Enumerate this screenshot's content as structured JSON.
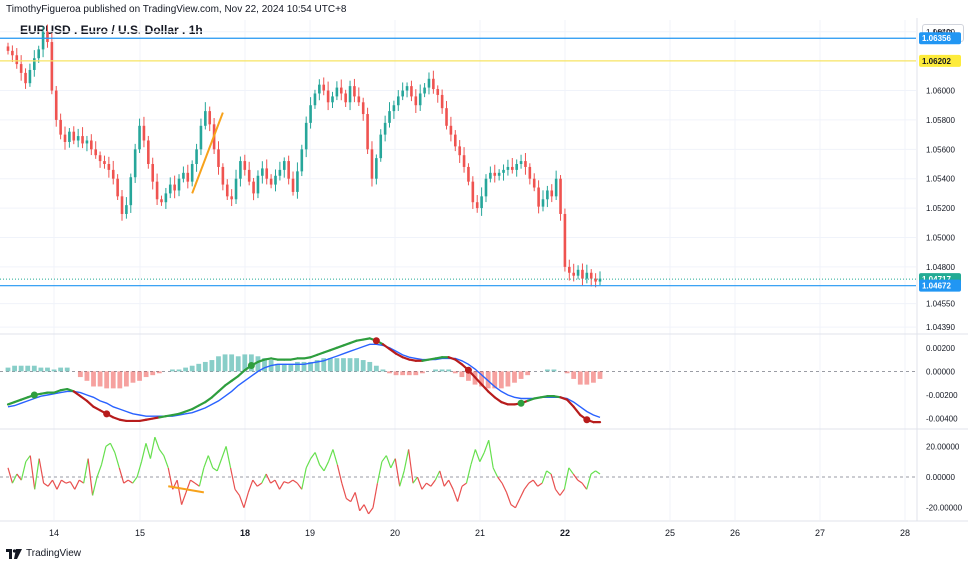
{
  "header": {
    "published_by": "TimothyFigueroa published on TradingView.com, Nov 22, 2024 10:54 UTC+8",
    "symbol_title": "EURUSD . Euro / U.S. Dollar . 1h",
    "currency_button": "USD"
  },
  "footer": {
    "brand": "TradingView"
  },
  "colors": {
    "up": "#26a69a",
    "down": "#ef5350",
    "blue_line": "#2196f3",
    "yellow_line": "#f7e463",
    "orange_trendline": "#f7a21b",
    "green_tag": "#22ab94",
    "blue_tag": "#2196f3",
    "yellow_tag": "#fdeb3b",
    "macd_fast": "#2e9e3e",
    "macd_fast_down": "#b71c1c",
    "macd_slow": "#2962ff",
    "osc_up": "#66e04e",
    "osc_down": "#e8504f"
  },
  "chart_data": [
    {
      "type": "candlestick",
      "title": "EURUSD . Euro / U.S. Dollar . 1h",
      "y_ticks": [
        "1.06400",
        "1.06000",
        "1.05800",
        "1.05600",
        "1.05400",
        "1.05200",
        "1.05000",
        "1.04800",
        "1.04550",
        "1.04390"
      ],
      "ylim": [
        1.0435,
        1.0648
      ],
      "x_ticks": [
        "14",
        "15",
        "18",
        "19",
        "20",
        "21",
        "22",
        "25",
        "26",
        "27",
        "28"
      ],
      "bold_x_ticks": [
        "18",
        "22"
      ],
      "closes": [
        1.0627,
        1.0624,
        1.0618,
        1.0612,
        1.0605,
        1.0614,
        1.0622,
        1.0628,
        1.064,
        1.0633,
        1.06,
        1.058,
        1.057,
        1.0565,
        1.0572,
        1.0566,
        1.0569,
        1.0564,
        1.0566,
        1.056,
        1.0556,
        1.0552,
        1.055,
        1.0546,
        1.054,
        1.0528,
        1.0516,
        1.0522,
        1.0541,
        1.056,
        1.0576,
        1.0566,
        1.055,
        1.0538,
        1.0526,
        1.0524,
        1.053,
        1.0536,
        1.0532,
        1.054,
        1.0544,
        1.0538,
        1.055,
        1.056,
        1.0576,
        1.0586,
        1.0577,
        1.056,
        1.0548,
        1.0536,
        1.0528,
        1.0526,
        1.054,
        1.0552,
        1.0546,
        1.0538,
        1.053,
        1.0542,
        1.0547,
        1.054,
        1.0536,
        1.0542,
        1.0546,
        1.0552,
        1.054,
        1.0531,
        1.0545,
        1.056,
        1.0578,
        1.059,
        1.0598,
        1.0604,
        1.06,
        1.0592,
        1.0596,
        1.0602,
        1.0598,
        1.0592,
        1.0603,
        1.0596,
        1.0592,
        1.0584,
        1.056,
        1.054,
        1.0554,
        1.057,
        1.0578,
        1.0586,
        1.059,
        1.0596,
        1.06,
        1.0603,
        1.0596,
        1.059,
        1.0598,
        1.0602,
        1.0608,
        1.0601,
        1.0597,
        1.0588,
        1.0576,
        1.057,
        1.0562,
        1.0556,
        1.0548,
        1.0538,
        1.0524,
        1.052,
        1.0528,
        1.054,
        1.0544,
        1.0542,
        1.0544,
        1.0546,
        1.0548,
        1.0546,
        1.055,
        1.0552,
        1.0548,
        1.054,
        1.0534,
        1.0521,
        1.0526,
        1.0532,
        1.0528,
        1.054,
        1.0516,
        1.048,
        1.0476,
        1.0474,
        1.0478,
        1.0472,
        1.0476,
        1.0472,
        1.047,
        1.0472
      ],
      "horizontal_levels": [
        {
          "price": 1.06356,
          "label": "1.06356",
          "role": "blue"
        },
        {
          "price": 1.06202,
          "label": "1.06202",
          "role": "yellow"
        },
        {
          "price": 1.04717,
          "label": "1.04717",
          "role": "green"
        },
        {
          "price": 1.04672,
          "label": "1.04672",
          "role": "blue"
        }
      ],
      "trendline": {
        "from_index": 42,
        "to_index": 49,
        "from_price": 1.053,
        "to_price": 1.0585
      }
    },
    {
      "type": "histogram+line",
      "y_ticks": [
        "0.00200",
        "0.00000",
        "-0.00200",
        "-0.00400"
      ],
      "ylim": [
        -0.0048,
        0.003
      ],
      "macd": [
        -0.0028,
        -0.0026,
        -0.0024,
        -0.0022,
        -0.002,
        -0.0019,
        -0.0018,
        -0.0018,
        -0.0016,
        -0.0015,
        -0.0017,
        -0.0021,
        -0.0025,
        -0.003,
        -0.0033,
        -0.0036,
        -0.0039,
        -0.0041,
        -0.0042,
        -0.0042,
        -0.0042,
        -0.0041,
        -0.004,
        -0.0039,
        -0.0038,
        -0.0037,
        -0.0036,
        -0.0034,
        -0.0032,
        -0.0029,
        -0.0026,
        -0.0022,
        -0.0017,
        -0.0012,
        -0.0008,
        -0.0004,
        0.0001,
        0.0005,
        0.0008,
        0.001,
        0.0011,
        0.001,
        0.001,
        0.001,
        0.0011,
        0.0011,
        0.0012,
        0.0014,
        0.0016,
        0.0018,
        0.002,
        0.0022,
        0.0024,
        0.0026,
        0.0027,
        0.0028,
        0.0026,
        0.0023,
        0.0019,
        0.0015,
        0.0012,
        0.001,
        0.0009,
        0.0009,
        0.001,
        0.0011,
        0.0012,
        0.0012,
        0.001,
        0.0006,
        0.0001,
        -0.0005,
        -0.0011,
        -0.0017,
        -0.0022,
        -0.0026,
        -0.0028,
        -0.0028,
        -0.0027,
        -0.0025,
        -0.0023,
        -0.0022,
        -0.0021,
        -0.0021,
        -0.0022,
        -0.0024,
        -0.003,
        -0.0037,
        -0.0041,
        -0.0043,
        -0.0043
      ],
      "signal": [
        -0.003,
        -0.0029,
        -0.0027,
        -0.0025,
        -0.0023,
        -0.0021,
        -0.002,
        -0.0019,
        -0.0018,
        -0.0017,
        -0.0017,
        -0.0018,
        -0.002,
        -0.0022,
        -0.0025,
        -0.0027,
        -0.003,
        -0.0032,
        -0.0034,
        -0.0036,
        -0.0037,
        -0.0038,
        -0.0038,
        -0.0038,
        -0.0038,
        -0.0038,
        -0.0037,
        -0.0036,
        -0.0035,
        -0.0033,
        -0.0031,
        -0.0028,
        -0.0025,
        -0.0021,
        -0.0017,
        -0.0012,
        -0.0008,
        -0.0004,
        0.0,
        0.0003,
        0.0005,
        0.0006,
        0.0006,
        0.0006,
        0.0006,
        0.0006,
        0.0007,
        0.0008,
        0.0009,
        0.0011,
        0.0013,
        0.0015,
        0.0017,
        0.0019,
        0.0021,
        0.0023,
        0.0023,
        0.0022,
        0.002,
        0.0017,
        0.0014,
        0.0012,
        0.0011,
        0.001,
        0.001,
        0.001,
        0.0011,
        0.0011,
        0.0011,
        0.0009,
        0.0006,
        0.0002,
        -0.0003,
        -0.0008,
        -0.0013,
        -0.0017,
        -0.002,
        -0.0022,
        -0.0023,
        -0.0023,
        -0.0023,
        -0.0022,
        -0.0022,
        -0.0022,
        -0.0022,
        -0.0023,
        -0.0026,
        -0.003,
        -0.0034,
        -0.0037,
        -0.0039
      ],
      "cross_points": [
        4,
        15,
        37,
        56,
        70,
        78,
        88
      ]
    },
    {
      "type": "line",
      "y_ticks": [
        "20.00000",
        "0.00000",
        "-20.00000"
      ],
      "ylim": [
        -28,
        30
      ],
      "values": [
        6,
        -4,
        2,
        -2,
        10,
        14,
        -8,
        12,
        -4,
        -6,
        -2,
        -8,
        -2,
        -4,
        -3,
        -8,
        -2,
        -4,
        12,
        -12,
        0,
        8,
        20,
        22,
        16,
        6,
        -4,
        -2,
        -4,
        0,
        10,
        22,
        12,
        26,
        18,
        14,
        6,
        -8,
        -2,
        -18,
        -10,
        -2,
        -4,
        -6,
        6,
        14,
        6,
        4,
        12,
        20,
        6,
        -8,
        -12,
        -20,
        -10,
        -2,
        -6,
        -4,
        2,
        -4,
        -2,
        -8,
        -3,
        -4,
        -2,
        -4,
        -8,
        6,
        12,
        16,
        8,
        4,
        10,
        18,
        8,
        -4,
        -14,
        -16,
        -10,
        -22,
        -18,
        -24,
        -20,
        -4,
        10,
        14,
        6,
        12,
        -6,
        4,
        18,
        -4,
        0,
        -8,
        -4,
        -6,
        -2,
        4,
        -6,
        -2,
        -8,
        -16,
        -6,
        -4,
        8,
        18,
        10,
        16,
        24,
        6,
        0,
        -4,
        -10,
        -18,
        -20,
        -14,
        -8,
        -4,
        -2,
        -6,
        -4,
        4,
        2,
        -8,
        -12,
        -8,
        6,
        2,
        -2,
        -4,
        -8,
        2,
        4,
        2
      ],
      "segment_line": {
        "from_index": 36,
        "to_index": 44,
        "from_value": -6,
        "to_value": -10
      }
    }
  ]
}
